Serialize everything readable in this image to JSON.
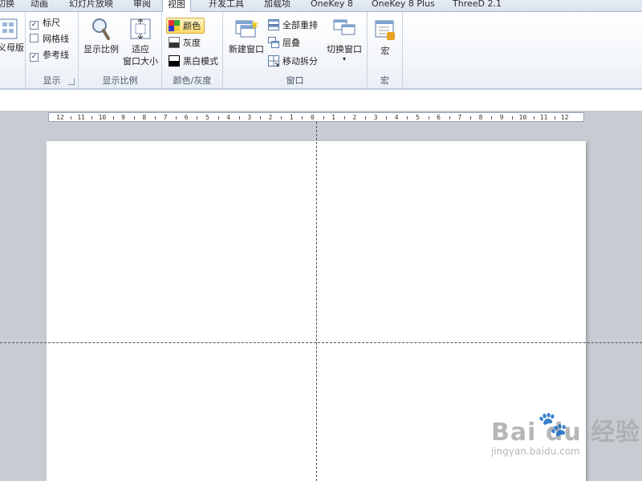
{
  "tabs": [
    {
      "label": "切换",
      "active": false
    },
    {
      "label": "动画",
      "active": false
    },
    {
      "label": "幻灯片放映",
      "active": false
    },
    {
      "label": "审阅",
      "active": false
    },
    {
      "label": "视图",
      "active": true
    },
    {
      "label": "开发工具",
      "active": false
    },
    {
      "label": "加载项",
      "active": false
    },
    {
      "label": "OneKey 8",
      "active": false
    },
    {
      "label": "OneKey 8 Plus",
      "active": false
    },
    {
      "label": "ThreeD 2.1",
      "active": false
    }
  ],
  "ribbon": {
    "master": {
      "label": "讲义母版"
    },
    "show": {
      "group_label": "显示",
      "ruler": {
        "label": "标尺",
        "checked": true
      },
      "gridlines": {
        "label": "网格线",
        "checked": false
      },
      "guides": {
        "label": "参考线",
        "checked": true
      }
    },
    "zoom": {
      "group_label": "显示比例",
      "zoom_button": "显示比例",
      "fit_button_line1": "适应",
      "fit_button_line2": "窗口大小"
    },
    "color": {
      "group_label": "颜色/灰度",
      "color": "颜色",
      "grayscale": "灰度",
      "bw": "黑白模式"
    },
    "window": {
      "group_label": "窗口",
      "new_window": "新建窗口",
      "arrange_all": "全部重排",
      "cascade": "层叠",
      "move_split": "移动拆分",
      "switch_window": "切换窗口"
    },
    "macro": {
      "group_label": "宏",
      "macro_button": "宏"
    }
  },
  "ruler": {
    "labels": [
      "12",
      "11",
      "10",
      "9",
      "8",
      "7",
      "6",
      "5",
      "4",
      "3",
      "2",
      "1",
      "0",
      "1",
      "2",
      "3",
      "4",
      "5",
      "6",
      "7",
      "8",
      "9",
      "10",
      "11",
      "12"
    ]
  },
  "watermark": {
    "logo": "Bai du 经验",
    "url": "jingyan.baidu.com"
  },
  "colors": {
    "accent_active": "#ffd96b",
    "ribbon_bg": "#f2f5f9",
    "workspace_bg": "#c7ccd3"
  }
}
